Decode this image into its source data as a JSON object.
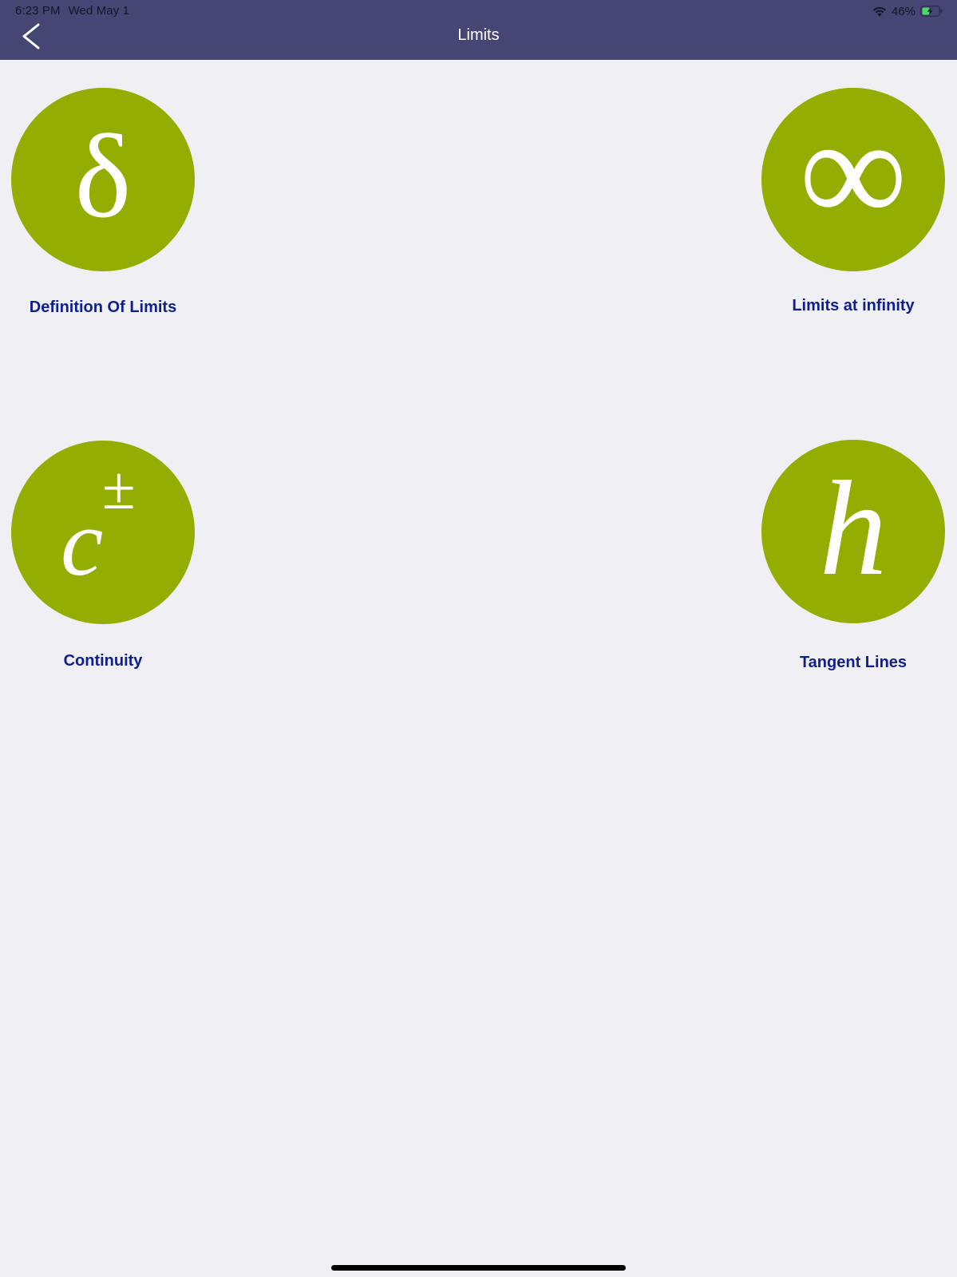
{
  "status_bar": {
    "time": "6:23 PM",
    "date": "Wed May 1",
    "battery_percent": "46%",
    "battery_level": 0.46
  },
  "navbar": {
    "title": "Limits",
    "back_icon": "chevron-left-icon",
    "background": "#454673"
  },
  "topics": [
    {
      "label": "Definition Of Limits",
      "symbol": "δ",
      "icon": "delta-icon"
    },
    {
      "label": "Limits at infinity",
      "symbol": "∞",
      "icon": "infinity-icon"
    },
    {
      "label": "Continuity",
      "symbol": "c",
      "superscript": "±",
      "icon": "c-plus-minus-icon"
    },
    {
      "label": "Tangent Lines",
      "symbol": "h",
      "icon": "h-icon"
    }
  ],
  "colors": {
    "circle": "#95ad00",
    "label": "#0f1f8c",
    "background": "#efeff4"
  }
}
